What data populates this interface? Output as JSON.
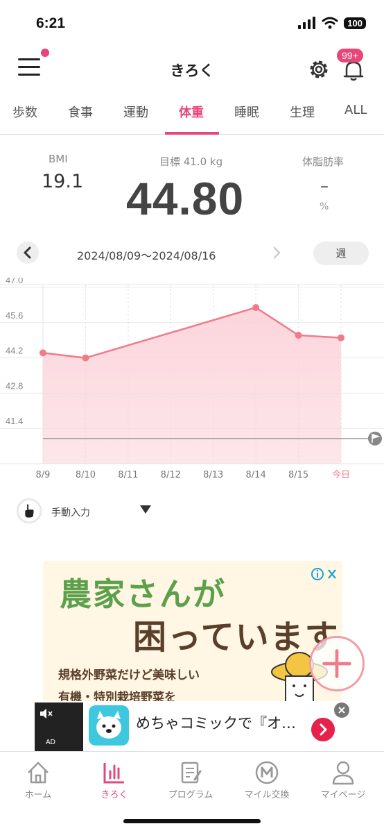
{
  "status_bar": {
    "time": "6:21",
    "battery": "100"
  },
  "header": {
    "title": "きろく",
    "notification_badge": "99+"
  },
  "tabs": [
    {
      "label": "歩数",
      "active": false
    },
    {
      "label": "食事",
      "active": false
    },
    {
      "label": "運動",
      "active": false
    },
    {
      "label": "体重",
      "active": true
    },
    {
      "label": "睡眠",
      "active": false
    },
    {
      "label": "生理",
      "active": false
    },
    {
      "label": "ALL",
      "active": false
    }
  ],
  "summary": {
    "bmi_label": "BMI",
    "bmi_value": "19.1",
    "goal_label": "目標 41.0 kg",
    "weight_value": "44.80",
    "fat_label": "体脂肪率",
    "fat_value": "–",
    "fat_unit": "%"
  },
  "date_nav": {
    "range": "2024/08/09～2024/08/16",
    "period": "週"
  },
  "chart_data": {
    "type": "area",
    "x": [
      "8/9",
      "8/10",
      "8/11",
      "8/12",
      "8/13",
      "8/14",
      "8/15",
      "今日"
    ],
    "series": [
      {
        "values": [
          44.4,
          44.2,
          null,
          null,
          null,
          46.2,
          45.1,
          45.0
        ]
      }
    ],
    "y_ticks": [
      47.0,
      45.6,
      44.2,
      42.8,
      41.4
    ],
    "y_tick_labels": [
      "47.0",
      "45.6",
      "44.2",
      "42.8",
      "41.4"
    ],
    "ylim": [
      40.0,
      47.0
    ],
    "goal_line": 41.0,
    "grid": true,
    "colors": {
      "line": "#f07b8a",
      "fill": "#fbd3da",
      "goal": "#999999"
    }
  },
  "manual_input": {
    "label": "手動入力"
  },
  "ad": {
    "title_line1": "農家さんが",
    "title_line2": "困っています",
    "sub_line1": "規格外野菜だけど美味しい",
    "sub_line2": "有機・特別栽培野菜を"
  },
  "banner": {
    "ad_label": "AD",
    "text": "めちゃコミックで『オ…"
  },
  "bottom_nav": [
    {
      "label": "ホーム",
      "icon": "home-icon",
      "active": false
    },
    {
      "label": "きろく",
      "icon": "chart-icon",
      "active": true
    },
    {
      "label": "プログラム",
      "icon": "program-icon",
      "active": false
    },
    {
      "label": "マイル交換",
      "icon": "mile-icon",
      "active": false
    },
    {
      "label": "マイページ",
      "icon": "person-icon",
      "active": false
    }
  ],
  "colors": {
    "accent": "#e8457a"
  }
}
